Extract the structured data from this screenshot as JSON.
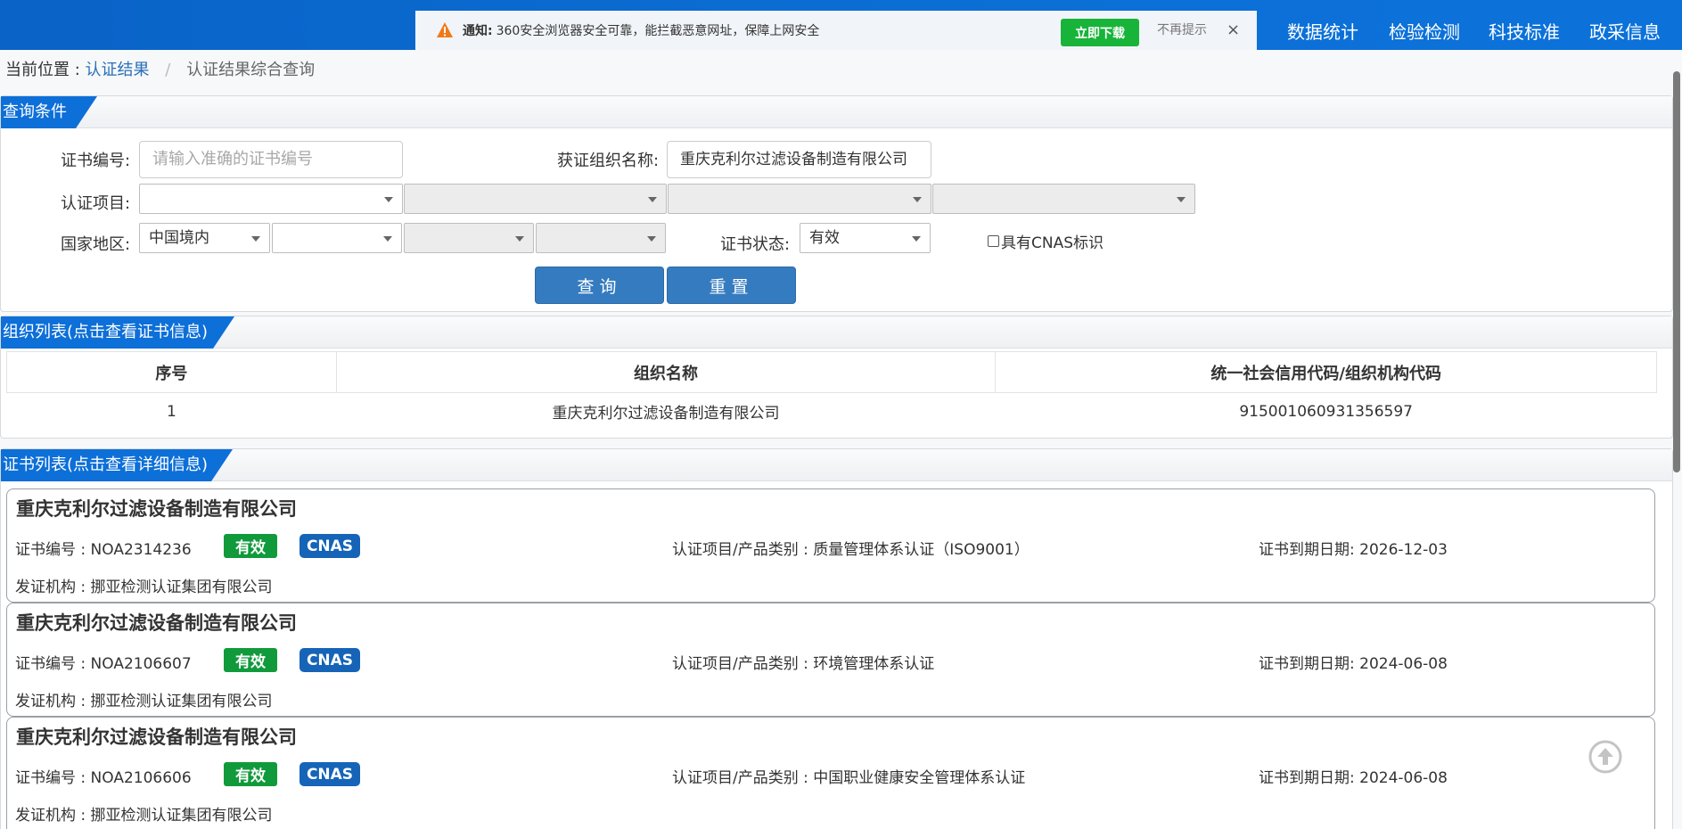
{
  "notice": {
    "title": "通知:",
    "text": "360安全浏览器安全可靠，能拦截恶意网址，保障上网安全",
    "download_label": "立即下载",
    "dismiss_label": "不再提示",
    "close_label": "×"
  },
  "topnav": [
    "数据统计",
    "检验检测",
    "科技标准",
    "政采信息"
  ],
  "breadcrumb": {
    "prefix": "当前位置 :",
    "link": "认证结果",
    "separator": "/",
    "current": "认证结果综合查询"
  },
  "query_panel": {
    "title": "查询条件",
    "cert_no_label": "证书编号:",
    "cert_no_placeholder": "请输入准确的证书编号",
    "org_name_label": "获证组织名称:",
    "org_name_value": "重庆克利尔过滤设备制造有限公司",
    "project_label": "认证项目:",
    "region_label": "国家地区:",
    "region_value": "中国境内",
    "status_label": "证书状态:",
    "status_value": "有效",
    "cnas_label": "具有CNAS标识",
    "query_button": "查询",
    "reset_button": "重置"
  },
  "org_panel": {
    "title": "组织列表(点击查看证书信息)",
    "columns": [
      "序号",
      "组织名称",
      "统一社会信用代码/组织机构代码"
    ],
    "rows": [
      [
        "1",
        "重庆克利尔过滤设备制造有限公司",
        "915001060931356597"
      ]
    ]
  },
  "cert_panel": {
    "title": "证书列表(点击查看详细信息)",
    "certs": [
      {
        "org": "重庆克利尔过滤设备制造有限公司",
        "cert_no": "证书编号 : NOA2314236",
        "status": "有效",
        "cnas": "CNAS",
        "project": "认证项目/产品类别 : 质量管理体系认证（ISO9001）",
        "expiry": "证书到期日期: 2026-12-03",
        "issuer": "发证机构 : 挪亚检测认证集团有限公司"
      },
      {
        "org": "重庆克利尔过滤设备制造有限公司",
        "cert_no": "证书编号 : NOA2106607",
        "status": "有效",
        "cnas": "CNAS",
        "project": "认证项目/产品类别 : 环境管理体系认证",
        "expiry": "证书到期日期: 2024-06-08",
        "issuer": "发证机构 : 挪亚检测认证集团有限公司"
      },
      {
        "org": "重庆克利尔过滤设备制造有限公司",
        "cert_no": "证书编号 : NOA2106606",
        "status": "有效",
        "cnas": "CNAS",
        "project": "认证项目/产品类别 : 中国职业健康安全管理体系认证",
        "expiry": "证书到期日期: 2024-06-08",
        "issuer": "发证机构 : 挪亚检测认证集团有限公司"
      }
    ]
  },
  "colors": {
    "header_blue": "#0b6fd6",
    "tab_blue": "#0d6fd8",
    "button_blue": "#357bbf",
    "valid_green": "#119a3b",
    "cnas_blue": "#1564b8",
    "download_green": "#18b43a"
  }
}
